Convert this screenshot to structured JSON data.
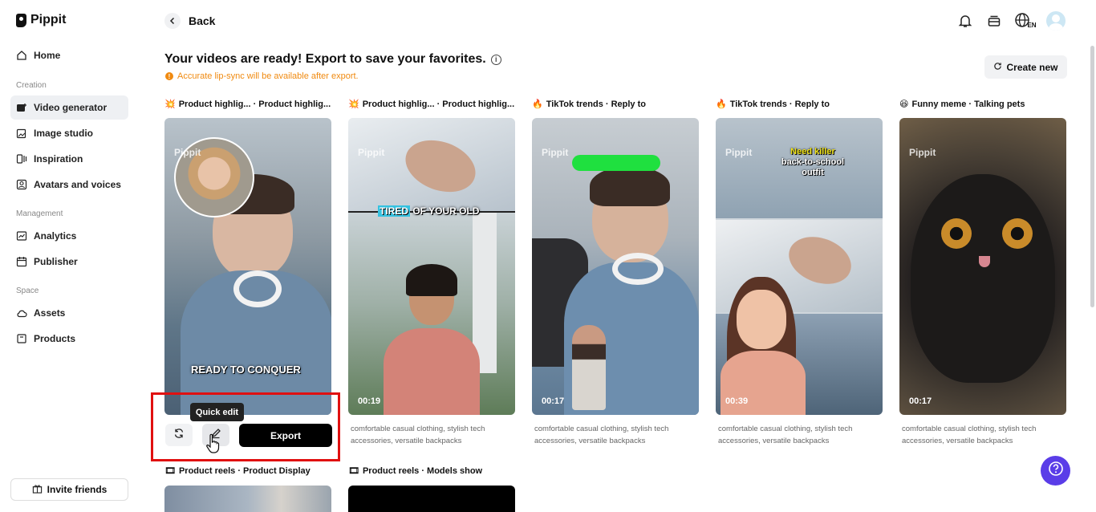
{
  "app": {
    "name": "Pippit"
  },
  "sidebar": {
    "items": [
      {
        "label": "Home",
        "icon": "home-icon"
      },
      {
        "label": "Video generator",
        "icon": "video-plus-icon",
        "active": true
      },
      {
        "label": "Image studio",
        "icon": "image-plus-icon"
      },
      {
        "label": "Inspiration",
        "icon": "inspiration-icon"
      },
      {
        "label": "Avatars and voices",
        "icon": "avatar-icon"
      },
      {
        "label": "Analytics",
        "icon": "chart-icon"
      },
      {
        "label": "Publisher",
        "icon": "calendar-icon"
      },
      {
        "label": "Assets",
        "icon": "cloud-icon"
      },
      {
        "label": "Products",
        "icon": "box-icon"
      }
    ],
    "sections": {
      "creation": "Creation",
      "management": "Management",
      "space": "Space"
    },
    "invite": "Invite friends"
  },
  "topbar": {
    "back": "Back",
    "language": "EN"
  },
  "header": {
    "title": "Your videos are ready! Export to save your favorites.",
    "notice": "Accurate lip-sync will be available after export.",
    "create_new": "Create new"
  },
  "cards": [
    {
      "emoji": "💥",
      "title": "Product highlig...  · Product highlig...",
      "caption": "READY TO CONQUER",
      "duration": "",
      "description": ""
    },
    {
      "emoji": "💥",
      "title": "Product highlig... · Product highlig...",
      "caption_a": "TIRED",
      "caption_b": "OF YOUR OLD",
      "duration": "00:19",
      "description": "comfortable casual clothing, stylish tech accessories, versatile backpacks"
    },
    {
      "emoji": "🔥",
      "title": "TikTok trends · Reply to",
      "duration": "00:17",
      "description": "comfortable casual clothing, stylish tech accessories, versatile backpacks"
    },
    {
      "emoji": "🔥",
      "title": "TikTok trends · Reply to",
      "caption_a": "Need killer",
      "caption_b": "back-to-school",
      "caption_c": "outfit",
      "duration": "00:39",
      "description": "comfortable casual clothing, stylish tech accessories, versatile backpacks"
    },
    {
      "emoji": "😆",
      "title": "Funny meme · Talking pets",
      "duration": "00:17",
      "description": "comfortable casual clothing, stylish tech accessories, versatile backpacks"
    }
  ],
  "row2": [
    {
      "emoji": "🎞",
      "title": "Product reels · Product Display"
    },
    {
      "emoji": "🎞",
      "title": "Product reels · Models show"
    }
  ],
  "watermark": "Pippit",
  "actions": {
    "tooltip": "Quick edit",
    "export": "Export"
  },
  "colors": {
    "accent": "#5a3de8",
    "notice": "#f08a10",
    "highlight": "#e01010"
  }
}
